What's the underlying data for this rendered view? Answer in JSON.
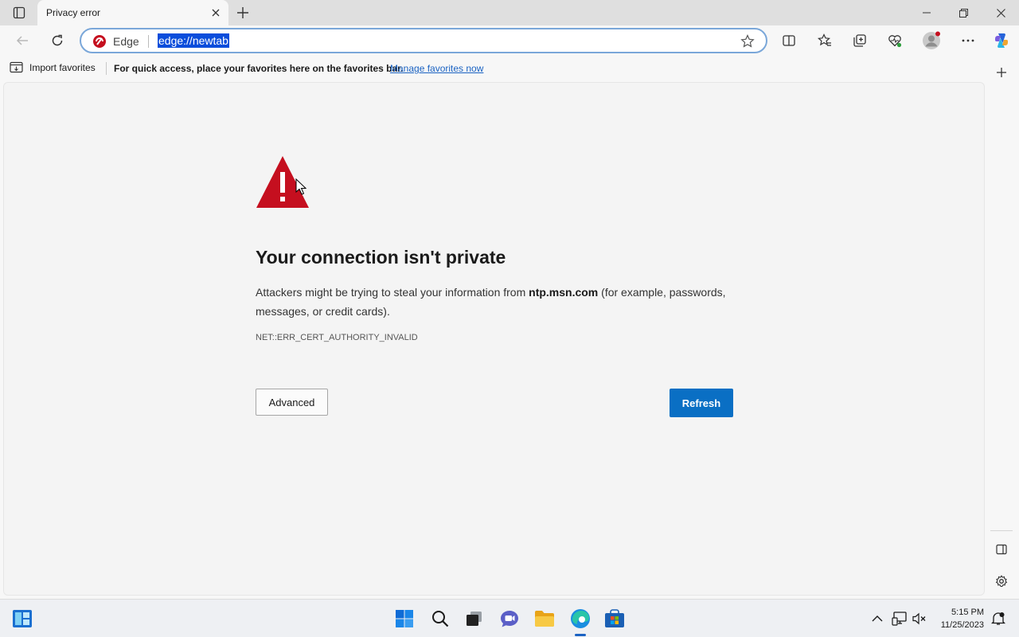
{
  "tab": {
    "title": "Privacy error"
  },
  "omnibox": {
    "site_label": "Edge",
    "url": "edge://newtab"
  },
  "favorites_bar": {
    "import_label": "Import favorites",
    "message": "For quick access, place your favorites here on the favorites bar.",
    "manage_link": "Manage favorites now"
  },
  "error_page": {
    "headline": "Your connection isn't private",
    "desc_prefix": "Attackers might be trying to steal your information from ",
    "desc_host": "ntp.msn.com",
    "desc_suffix": " (for example, passwords, messages, or credit cards).",
    "error_code": "NET::ERR_CERT_AUTHORITY_INVALID",
    "advanced_label": "Advanced",
    "refresh_label": "Refresh"
  },
  "taskbar": {
    "time": "5:15 PM",
    "date": "11/25/2023"
  },
  "colors": {
    "accent": "#0a6fc4",
    "warning": "#c50f1f",
    "link": "#1a62c2"
  }
}
